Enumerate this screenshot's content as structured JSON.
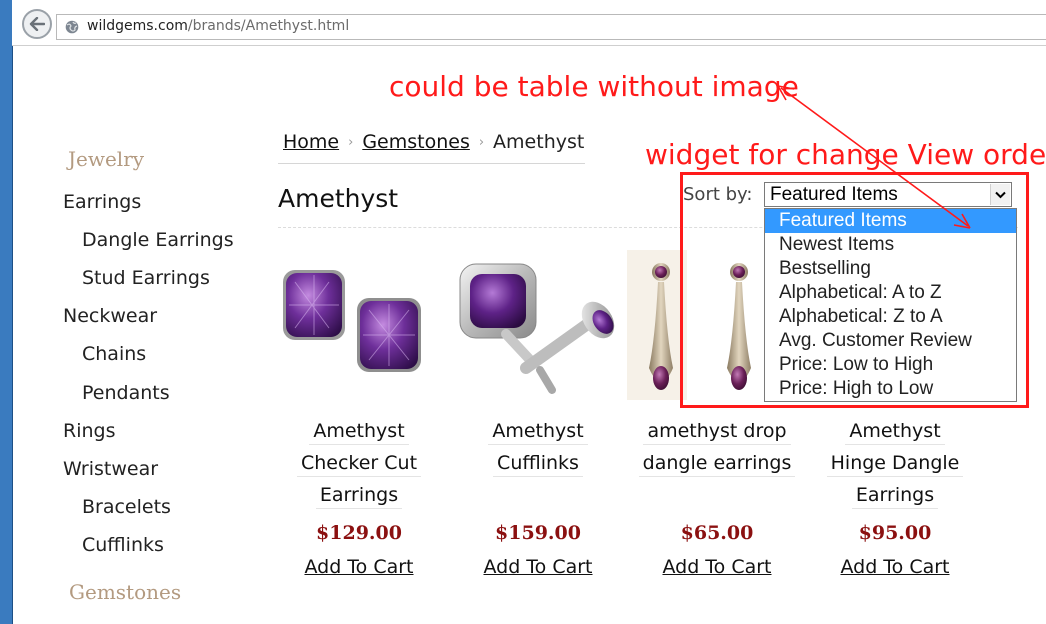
{
  "browser": {
    "url_domain": "wildgems.com",
    "url_path": "/brands/Amethyst.html"
  },
  "sidebar": {
    "jewelry_heading": "Jewelry",
    "items": [
      "Earrings",
      "Dangle Earrings",
      "Stud Earrings",
      "Neckwear",
      "Chains",
      "Pendants",
      "Rings",
      "Wristwear",
      "Bracelets",
      "Cufflinks"
    ],
    "gemstones_heading": "Gemstones"
  },
  "breadcrumb": {
    "home": "Home",
    "gemstones": "Gemstones",
    "current": "Amethyst",
    "separator": "›"
  },
  "page": {
    "title": "Amethyst"
  },
  "products": [
    {
      "name_lines": [
        "Amethyst",
        "Checker Cut",
        "Earrings"
      ],
      "price": "$129.00",
      "cart": "Add To Cart"
    },
    {
      "name_lines": [
        "Amethyst",
        "Cufflinks"
      ],
      "price": "$159.00",
      "cart": "Add To Cart"
    },
    {
      "name_lines": [
        "amethyst drop",
        "dangle earrings"
      ],
      "price": "$65.00",
      "cart": "Add To Cart"
    },
    {
      "name_lines": [
        "Amethyst",
        "Hinge Dangle",
        "Earrings"
      ],
      "price": "$95.00",
      "cart": "Add To Cart"
    }
  ],
  "sort": {
    "label": "Sort by:",
    "selected": "Featured Items",
    "options": [
      "Featured Items",
      "Newest Items",
      "Bestselling",
      "Alphabetical: A to Z",
      "Alphabetical: Z to A",
      "Avg. Customer Review",
      "Price: Low to High",
      "Price: High to Low"
    ]
  },
  "annotations": {
    "table_note": "could be table without image",
    "widget_note": "widget for change View order",
    "color": "#ff1a1a"
  },
  "colors": {
    "price": "#8b1010",
    "heading": "#b39a80",
    "selected_option": "#3399ff"
  }
}
